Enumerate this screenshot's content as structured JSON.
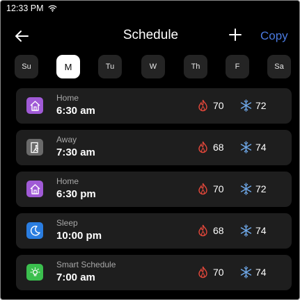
{
  "status_bar": {
    "time": "12:33 PM",
    "wifi_icon": "wifi-icon"
  },
  "header": {
    "title": "Schedule",
    "copy_label": "Copy",
    "back_icon": "arrow-left-icon",
    "add_icon": "plus-icon"
  },
  "days": [
    {
      "label": "Su",
      "selected": false
    },
    {
      "label": "M",
      "selected": true
    },
    {
      "label": "Tu",
      "selected": false
    },
    {
      "label": "W",
      "selected": false
    },
    {
      "label": "Th",
      "selected": false
    },
    {
      "label": "F",
      "selected": false
    },
    {
      "label": "Sa",
      "selected": false
    }
  ],
  "schedule": [
    {
      "mode": "Home",
      "time": "6:30 am",
      "heat": "70",
      "cool": "72",
      "icon": "home-icon",
      "color": "#a05ad6"
    },
    {
      "mode": "Away",
      "time": "7:30 am",
      "heat": "68",
      "cool": "74",
      "icon": "away-icon",
      "color": "#6a6a6a"
    },
    {
      "mode": "Home",
      "time": "6:30 pm",
      "heat": "70",
      "cool": "72",
      "icon": "home-icon",
      "color": "#a05ad6"
    },
    {
      "mode": "Sleep",
      "time": "10:00 pm",
      "heat": "68",
      "cool": "74",
      "icon": "moon-icon",
      "color": "#2a7de0"
    },
    {
      "mode": "Smart Schedule",
      "time": "7:00 am",
      "heat": "70",
      "cool": "74",
      "icon": "bulb-icon",
      "color": "#3bbf4e"
    }
  ],
  "colors": {
    "heat": "#e2473a",
    "cool": "#6fa8e8",
    "accent": "#4a7ae0"
  }
}
